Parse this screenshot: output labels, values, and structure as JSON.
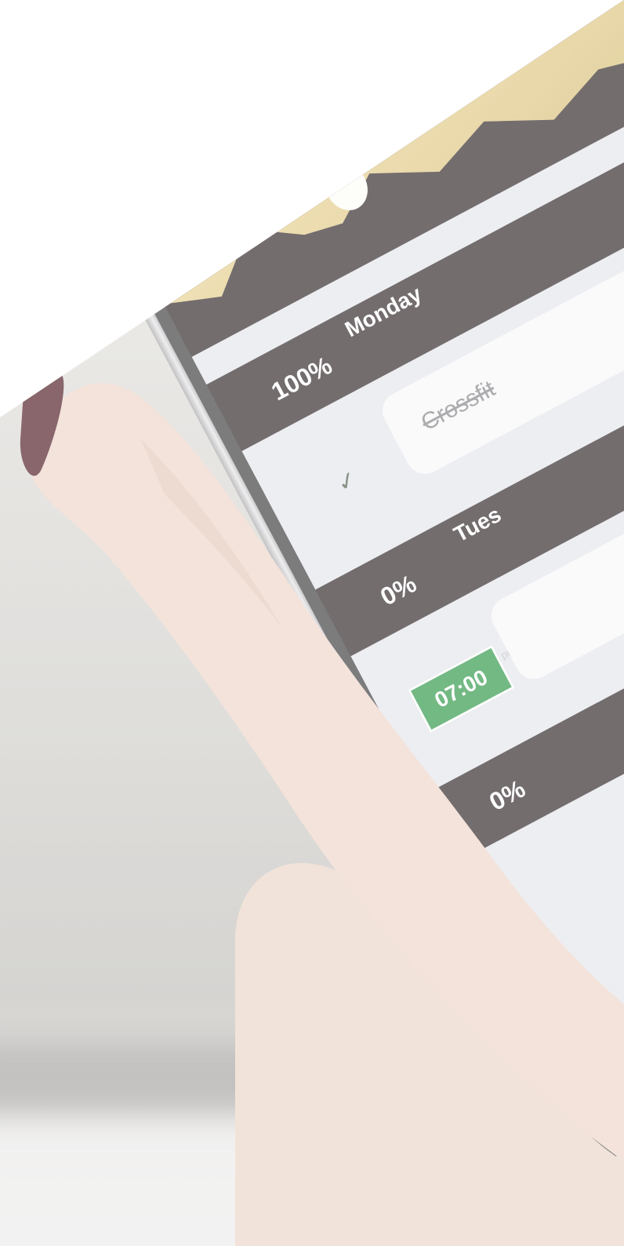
{
  "app": {
    "days": [
      {
        "percent": "100%",
        "name": "Monday",
        "task": "Crossfit",
        "status_icon": "checkmark-icon"
      },
      {
        "percent": "0%",
        "name": "Tues",
        "time": "07:00",
        "time_suffix": "pm"
      },
      {
        "percent": "0%"
      }
    ]
  },
  "colors": {
    "header_dark": "#3d3536",
    "list_background": "#e7e8ee",
    "time_badge": "#3d9e55",
    "header_art": "#ead59a",
    "nail_polish": "#5a2c33",
    "skin": "#ead5c8"
  }
}
